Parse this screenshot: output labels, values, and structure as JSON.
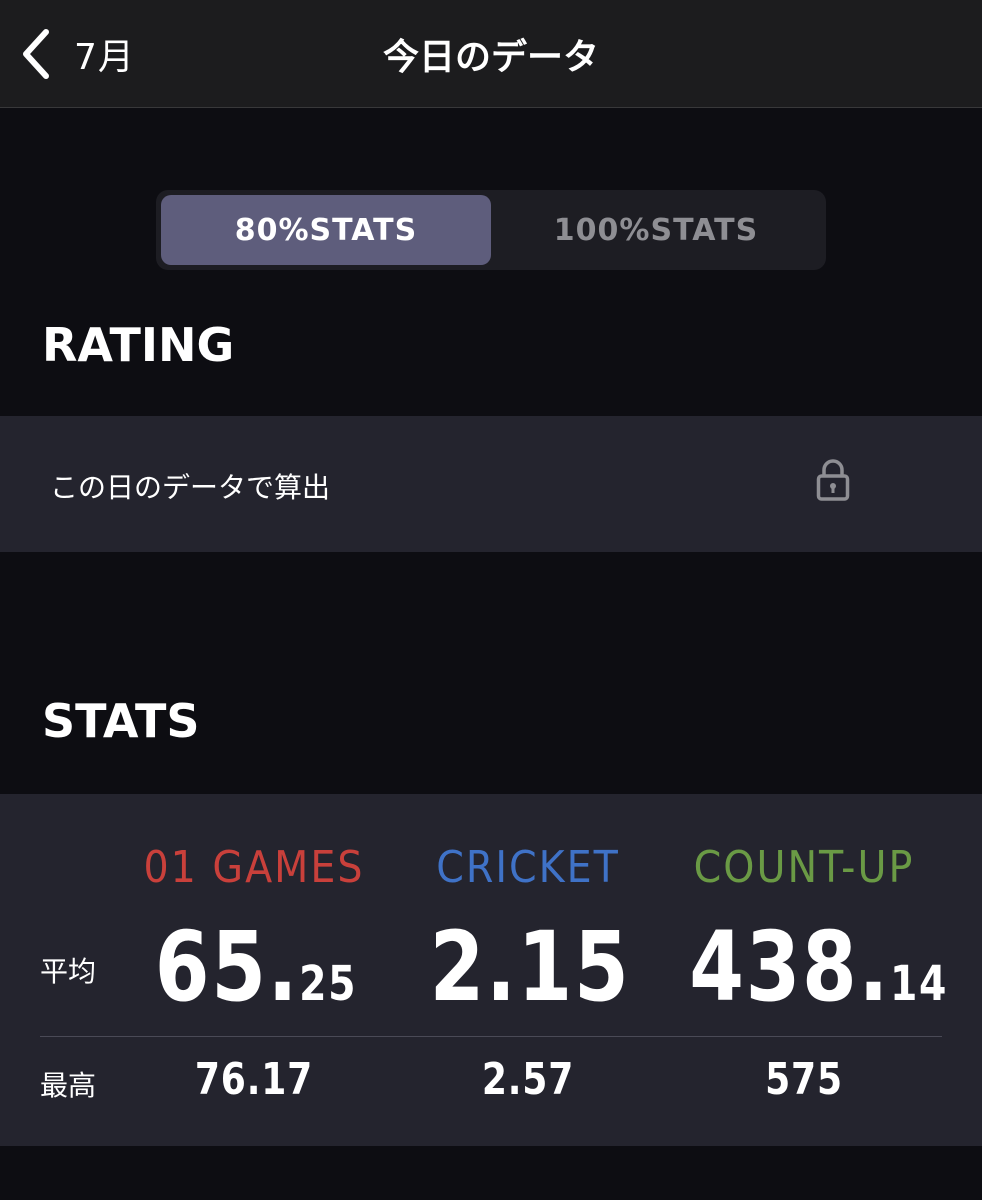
{
  "navbar": {
    "back_label": "7月",
    "title": "今日のデータ"
  },
  "segmented": {
    "options": [
      {
        "label": "80%STATS",
        "selected": true
      },
      {
        "label": "100%STATS",
        "selected": false
      }
    ]
  },
  "rating": {
    "title": "RATING",
    "row_text": "この日のデータで算出",
    "icon": "lock-icon"
  },
  "stats": {
    "title": "STATS",
    "row_labels": {
      "average": "平均",
      "max": "最高"
    },
    "columns": [
      {
        "name": "01 GAMES",
        "color": "#c9403b",
        "average_int": "65.",
        "average_dec": "25",
        "max": "76.17"
      },
      {
        "name": "CRICKET",
        "color": "#3f72c7",
        "average_int": "2.15",
        "average_dec": "",
        "max": "2.57"
      },
      {
        "name": "COUNT-UP",
        "color": "#6a9a45",
        "average_int": "438.",
        "average_dec": "14",
        "max": "575"
      }
    ]
  },
  "colors": {
    "background": "#0d0d12",
    "navbar": "#1c1c1e",
    "panel": "#24242e",
    "segment_active": "#5e5d7c"
  }
}
